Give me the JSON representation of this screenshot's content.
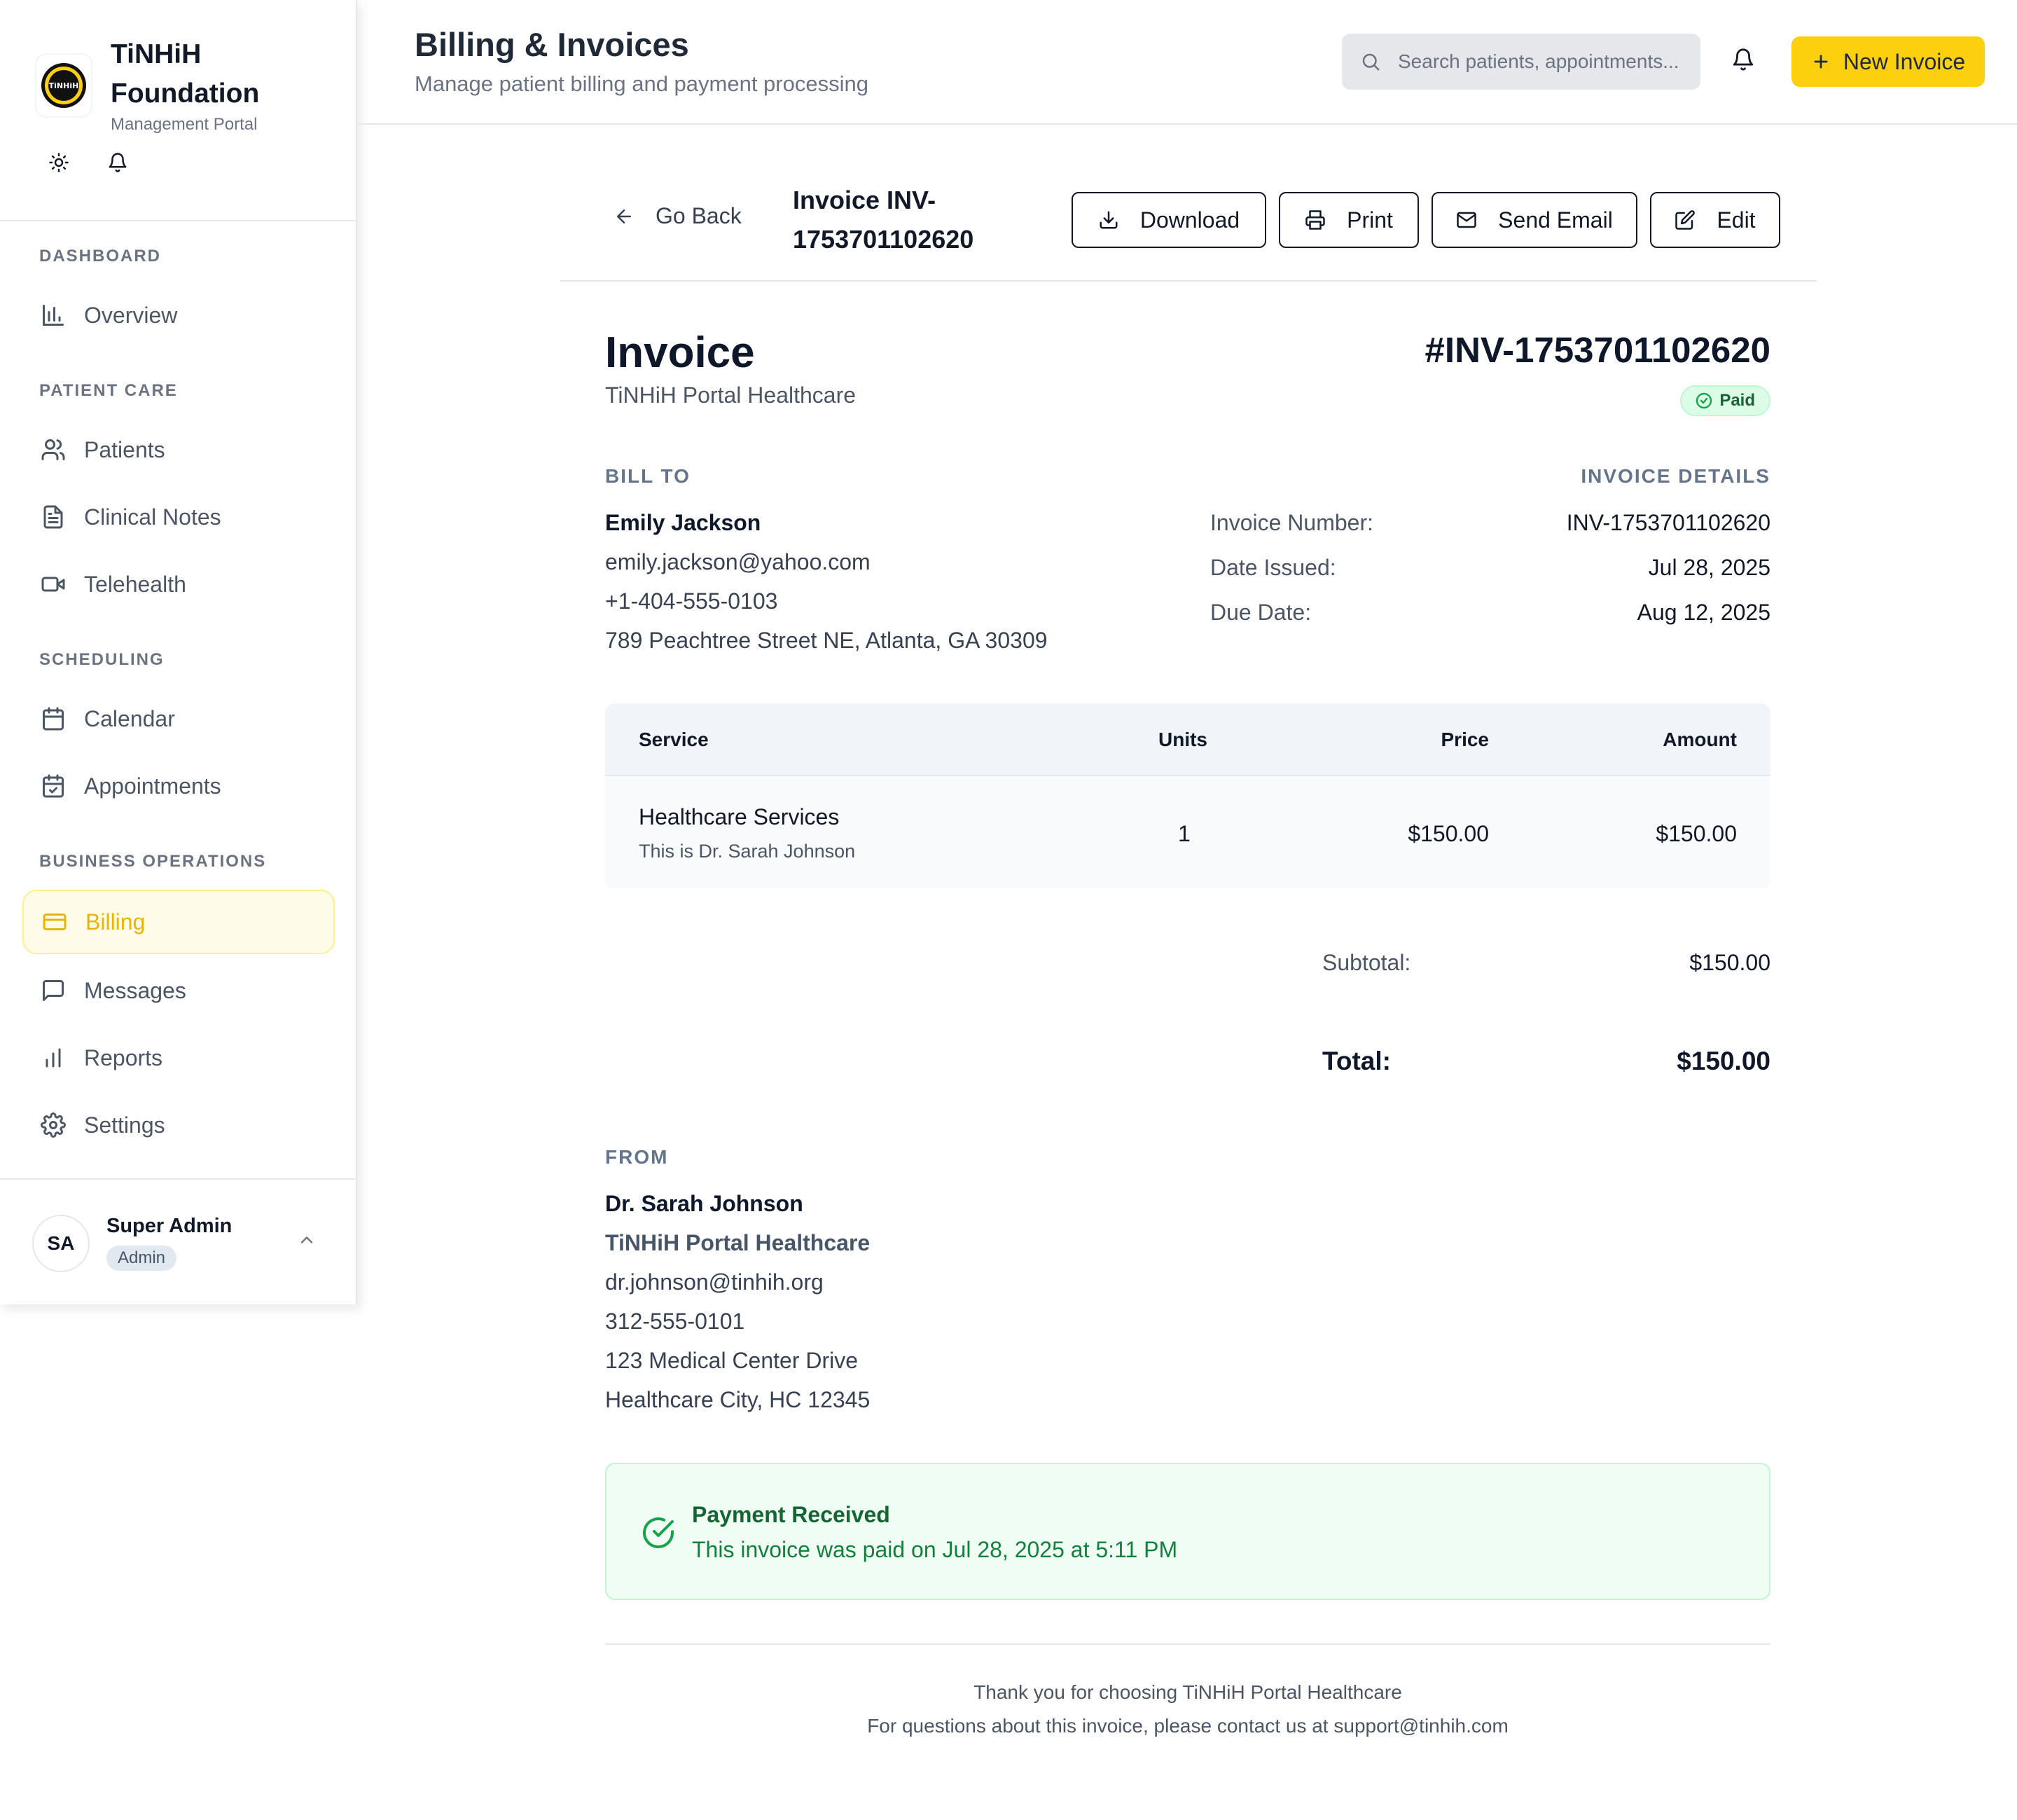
{
  "brand": {
    "name": "TiNHiH Foundation",
    "subtitle": "Management Portal",
    "logo_text": "TiNHiH"
  },
  "nav": {
    "sections": {
      "dashboard": "DASHBOARD",
      "patient_care": "PATIENT CARE",
      "scheduling": "SCHEDULING",
      "business": "BUSINESS OPERATIONS"
    },
    "items": {
      "overview": "Overview",
      "patients": "Patients",
      "clinical_notes": "Clinical Notes",
      "telehealth": "Telehealth",
      "calendar": "Calendar",
      "appointments": "Appointments",
      "billing": "Billing",
      "messages": "Messages",
      "reports": "Reports",
      "settings": "Settings"
    },
    "active": "billing"
  },
  "user": {
    "initials": "SA",
    "name": "Super Admin",
    "role": "Admin"
  },
  "header": {
    "title": "Billing & Invoices",
    "subtitle": "Manage patient billing and payment processing",
    "search_placeholder": "Search patients, appointments...",
    "new_invoice_label": "New Invoice"
  },
  "toolbar": {
    "go_back": "Go Back",
    "invoice_title": "Invoice INV-1753701102620",
    "download": "Download",
    "print": "Print",
    "send_email": "Send Email",
    "edit": "Edit"
  },
  "invoice": {
    "heading": "Invoice",
    "company": "TiNHiH Portal Healthcare",
    "number_display": "#INV-1753701102620",
    "status": "Paid",
    "bill_to_label": "BILL TO",
    "details_label": "INVOICE DETAILS",
    "bill_to": {
      "name": "Emily Jackson",
      "email": "emily.jackson@yahoo.com",
      "phone": "+1-404-555-0103",
      "address": "789 Peachtree Street NE, Atlanta, GA 30309"
    },
    "details": {
      "number_label": "Invoice Number:",
      "number": "INV-1753701102620",
      "issued_label": "Date Issued:",
      "issued": "Jul 28, 2025",
      "due_label": "Due Date:",
      "due": "Aug 12, 2025"
    },
    "table": {
      "headers": [
        "Service",
        "Units",
        "Price",
        "Amount"
      ],
      "rows": [
        {
          "service": "Healthcare Services",
          "description": "This is Dr. Sarah Johnson",
          "units": "1",
          "price": "$150.00",
          "amount": "$150.00"
        }
      ]
    },
    "subtotal_label": "Subtotal:",
    "subtotal": "$150.00",
    "total_label": "Total:",
    "total": "$150.00",
    "from_label": "FROM",
    "from": {
      "name": "Dr. Sarah Johnson",
      "org": "TiNHiH Portal Healthcare",
      "email": "dr.johnson@tinhih.org",
      "phone": "312-555-0101",
      "address1": "123 Medical Center Drive",
      "address2": "Healthcare City, HC 12345"
    },
    "payment": {
      "title": "Payment Received",
      "text": "This invoice was paid on Jul 28, 2025 at 5:11 PM"
    },
    "footer": {
      "line1": "Thank you for choosing TiNHiH Portal Healthcare",
      "line2": "For questions about this invoice, please contact us at support@tinhih.com"
    }
  },
  "colors": {
    "accent": "#fcd00f",
    "active_nav_text": "#eab308",
    "active_nav_bg": "#fefce8",
    "paid_green": "#16a34a"
  },
  "icons": [
    "logo",
    "sun-icon",
    "bell-icon",
    "bar-chart-icon",
    "users-icon",
    "file-text-icon",
    "video-icon",
    "calendar-icon",
    "calendar-check-icon",
    "credit-card-icon",
    "message-square-icon",
    "signal-bars-icon",
    "gear-icon",
    "chevron-up-icon",
    "search-icon",
    "plus-icon",
    "arrow-left-icon",
    "download-icon",
    "printer-icon",
    "mail-icon",
    "edit-icon",
    "check-circle-icon"
  ]
}
